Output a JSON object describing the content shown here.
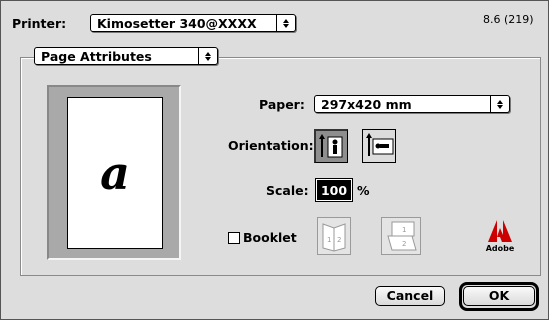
{
  "printer": {
    "label": "Printer:",
    "selected": "Kimosetter 340@XXXX"
  },
  "version": "8.6 (219)",
  "panel": {
    "selected": "Page Attributes"
  },
  "preview": {
    "glyph": "a"
  },
  "paper": {
    "label": "Paper:",
    "selected": "297x420 mm"
  },
  "orientation": {
    "label": "Orientation:",
    "options": [
      {
        "name": "portrait",
        "icon": "portrait-orientation-icon",
        "selected": true
      },
      {
        "name": "landscape",
        "icon": "landscape-orientation-icon",
        "selected": false
      }
    ]
  },
  "scale": {
    "label": "Scale:",
    "value": "100",
    "unit": "%"
  },
  "booklet": {
    "label": "Booklet",
    "checked": false,
    "options": [
      {
        "icon": "booklet-side-fold-icon",
        "enabled": false
      },
      {
        "icon": "booklet-top-fold-icon",
        "enabled": false
      }
    ]
  },
  "logo": {
    "text": "Adobe",
    "color": "#cc0000"
  },
  "buttons": {
    "cancel": "Cancel",
    "ok": "OK"
  }
}
